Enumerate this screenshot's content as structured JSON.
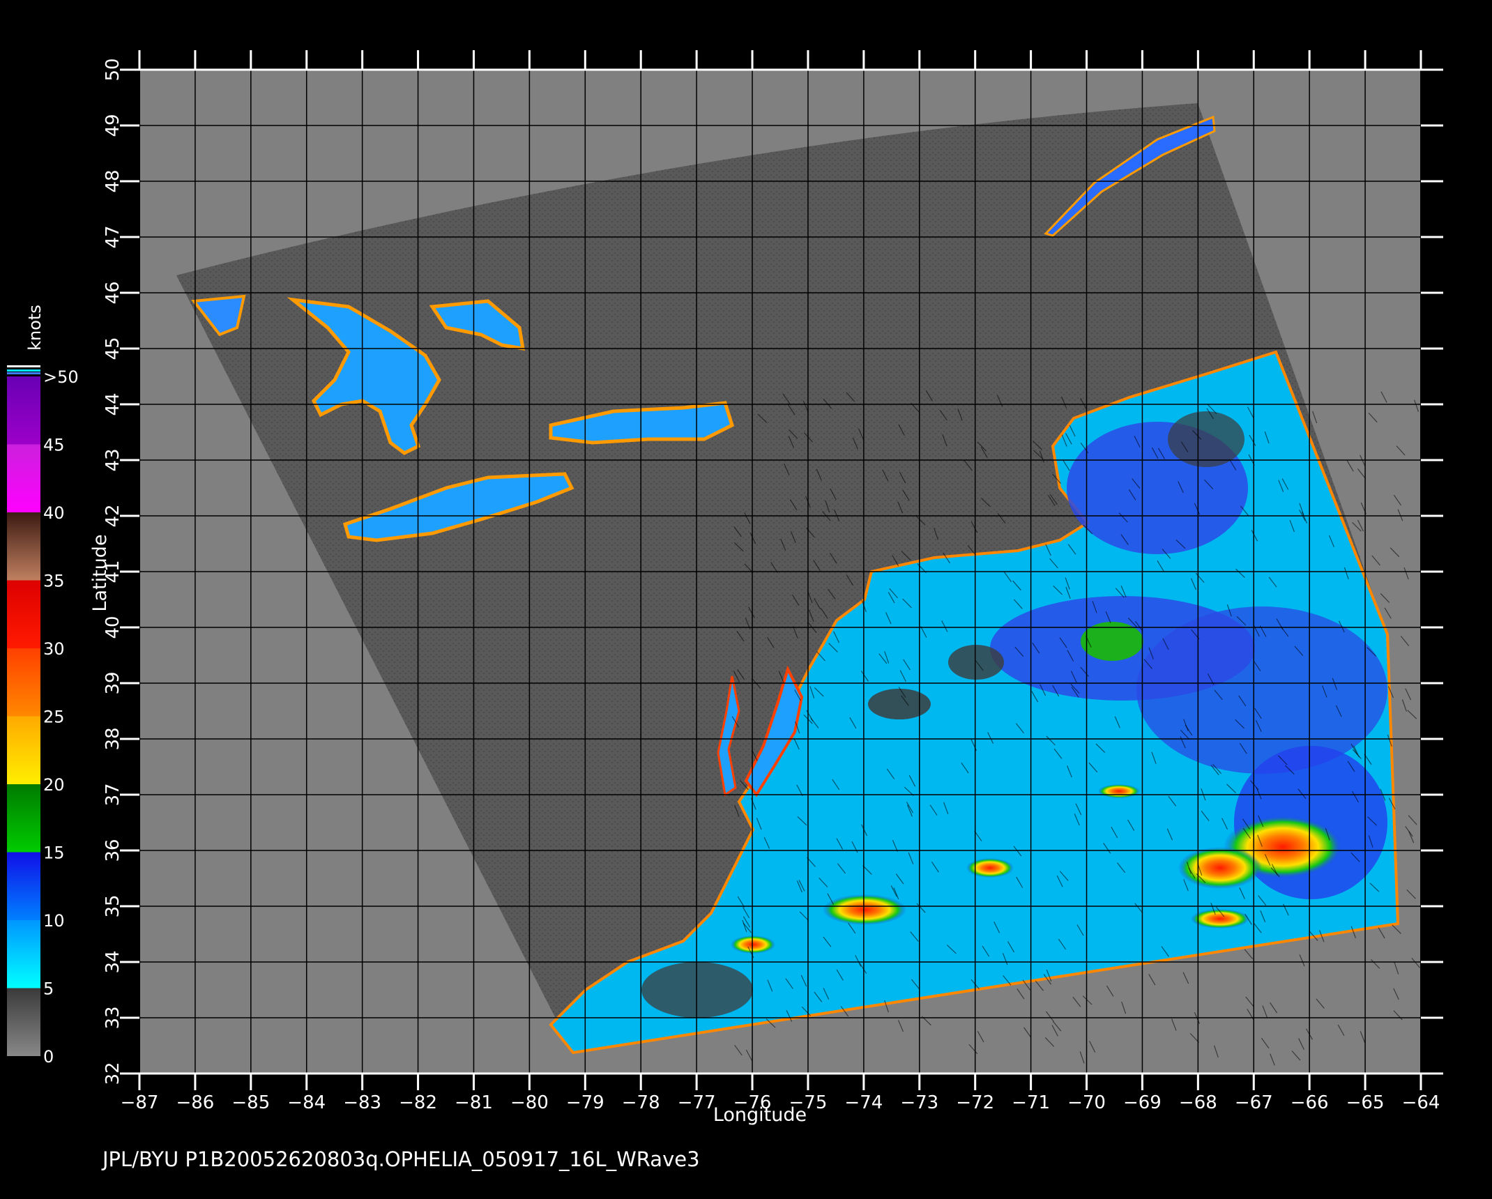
{
  "title": "JPL/BYU  P1B20052620803q.OPHELIA_050917_16L_WRave3",
  "map": {
    "x_axis": {
      "label": "Longitude",
      "range": [
        -87,
        -64
      ],
      "ticks": [
        -87,
        -86,
        -85,
        -84,
        -83,
        -82,
        -81,
        -80,
        -79,
        -78,
        -77,
        -76,
        -75,
        -74,
        -73,
        -72,
        -71,
        -70,
        -69,
        -68,
        -67,
        -66,
        -65,
        -64
      ]
    },
    "y_axis": {
      "label": "Latitude",
      "range": [
        32,
        50
      ],
      "ticks": [
        32,
        33,
        34,
        35,
        36,
        37,
        38,
        39,
        40,
        41,
        42,
        43,
        44,
        45,
        46,
        47,
        48,
        49,
        50
      ]
    },
    "grid": true,
    "colors": {
      "land_out_of_swath": "#808080",
      "swath_land": "#595959",
      "calm": "#3c3c3c"
    }
  },
  "colorbar": {
    "title": "knots",
    "labels": [
      "0",
      "5",
      "10",
      "15",
      "20",
      "25",
      "30",
      "35",
      "40",
      "45",
      ">50"
    ],
    "segments": [
      {
        "from": 0,
        "to": 5,
        "colors": [
          "#888888",
          "#3a3a3a"
        ]
      },
      {
        "from": 5,
        "to": 10,
        "colors": [
          "#00ffff",
          "#0096ff"
        ]
      },
      {
        "from": 10,
        "to": 15,
        "colors": [
          "#0080ff",
          "#1010e8"
        ]
      },
      {
        "from": 15,
        "to": 20,
        "colors": [
          "#00cc00",
          "#007a00"
        ]
      },
      {
        "from": 20,
        "to": 25,
        "colors": [
          "#ffee00",
          "#ffaa00"
        ]
      },
      {
        "from": 25,
        "to": 30,
        "colors": [
          "#ff8800",
          "#ff4000"
        ]
      },
      {
        "from": 30,
        "to": 35,
        "colors": [
          "#ff1a00",
          "#dd0000"
        ]
      },
      {
        "from": 35,
        "to": 40,
        "colors": [
          "#c08060",
          "#3c1a12"
        ]
      },
      {
        "from": 40,
        "to": 45,
        "colors": [
          "#ff00ff",
          "#cc20dd"
        ]
      },
      {
        "from": 45,
        "to": 50,
        "colors": [
          "#9c00c8",
          "#6800b4"
        ]
      }
    ]
  }
}
